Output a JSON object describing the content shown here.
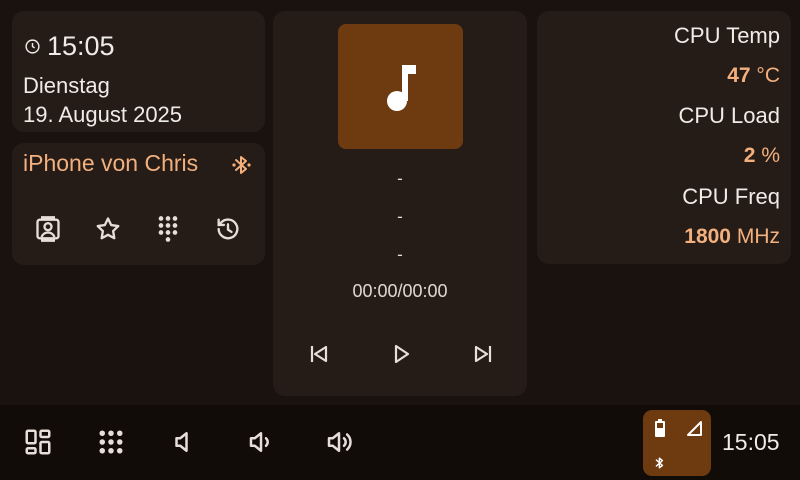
{
  "clock": {
    "time": "15:05",
    "day": "Dienstag",
    "date": "19. August 2025"
  },
  "phone": {
    "device_name": "iPhone von Chris"
  },
  "media": {
    "title": "-",
    "artist": "-",
    "album": "-",
    "progress": "00:00/00:00"
  },
  "stats": {
    "cpu_temp_label": "CPU Temp",
    "cpu_temp_value": "47",
    "cpu_temp_unit": "°C",
    "cpu_load_label": "CPU Load",
    "cpu_load_value": "2",
    "cpu_load_unit": "%",
    "cpu_freq_label": "CPU Freq",
    "cpu_freq_value": "1800",
    "cpu_freq_unit": "MHz"
  },
  "taskbar": {
    "time": "15:05"
  },
  "colors": {
    "background": "#1a120e",
    "card": "#251c17",
    "accent": "#f3b07d",
    "accent_fill": "#6d3b0f",
    "taskbar": "#120c09"
  },
  "icons": {
    "clock": "clock-icon",
    "bluetooth": "bluetooth-icon",
    "contacts": "contacts-icon",
    "favorites": "star-icon",
    "dialpad": "dialpad-icon",
    "history": "history-icon",
    "music": "music-note-icon",
    "prev": "skip-previous-icon",
    "play": "play-icon",
    "next": "skip-next-icon",
    "dashboard": "dashboard-icon",
    "apps": "apps-grid-icon",
    "vol_mute": "volume-mute-icon",
    "vol_down": "volume-down-icon",
    "vol_up": "volume-up-icon",
    "battery": "battery-icon",
    "signal": "signal-icon"
  }
}
